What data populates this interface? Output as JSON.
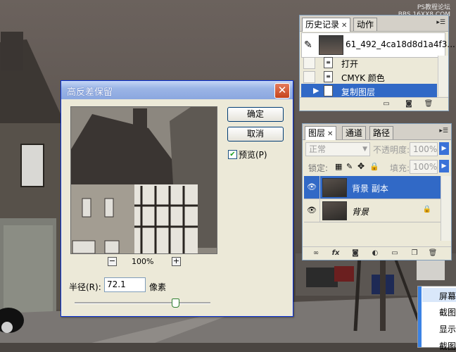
{
  "watermark": {
    "line1": "PS教程论坛",
    "line2": "BBS.16XX8.COM"
  },
  "history_panel": {
    "tabs": [
      {
        "label": "历史记录",
        "active": true,
        "closable": true
      },
      {
        "label": "动作",
        "active": false
      }
    ],
    "snapshot_name": "61_492_4ca18d8d1a4f3...",
    "items": [
      {
        "label": "打开",
        "selected": false
      },
      {
        "label": "CMYK 颜色",
        "selected": false
      },
      {
        "label": "复制图层",
        "selected": true
      }
    ],
    "footer_icons": [
      "new-document-icon",
      "snapshot-icon",
      "trash-icon"
    ]
  },
  "layers_panel": {
    "tabs": [
      {
        "label": "图层",
        "active": true,
        "closable": true
      },
      {
        "label": "通道",
        "active": false
      },
      {
        "label": "路径",
        "active": false
      }
    ],
    "blend_mode": "正常",
    "opacity_label": "不透明度:",
    "opacity_value": "100%",
    "lock_label": "锁定:",
    "fill_label": "填充:",
    "fill_value": "100%",
    "layers": [
      {
        "name": "背景 副本",
        "selected": true,
        "visible": true,
        "locked": false
      },
      {
        "name": "背景",
        "selected": false,
        "visible": true,
        "locked": true,
        "italic": true
      }
    ],
    "footer_icons": [
      "link-icon",
      "fx-icon",
      "mask-icon",
      "adjustment-icon",
      "group-icon",
      "new-layer-icon",
      "trash-icon"
    ]
  },
  "dialog": {
    "title": "高反差保留",
    "ok_label": "确定",
    "cancel_label": "取消",
    "preview_label": "预览(P)",
    "preview_checked": true,
    "zoom_value": "100%",
    "radius_label": "半径(R):",
    "radius_value": "72.1",
    "radius_unit": "像素",
    "radius_slider_fraction": 0.74
  },
  "context_menu": {
    "items": [
      "屏幕",
      "截图",
      "显示",
      "截图"
    ],
    "highlight_index": 0
  },
  "colors": {
    "selection_blue": "#3169c6",
    "xp_title_blue": "#0831d9",
    "panel_gray": "#ece9d8"
  }
}
